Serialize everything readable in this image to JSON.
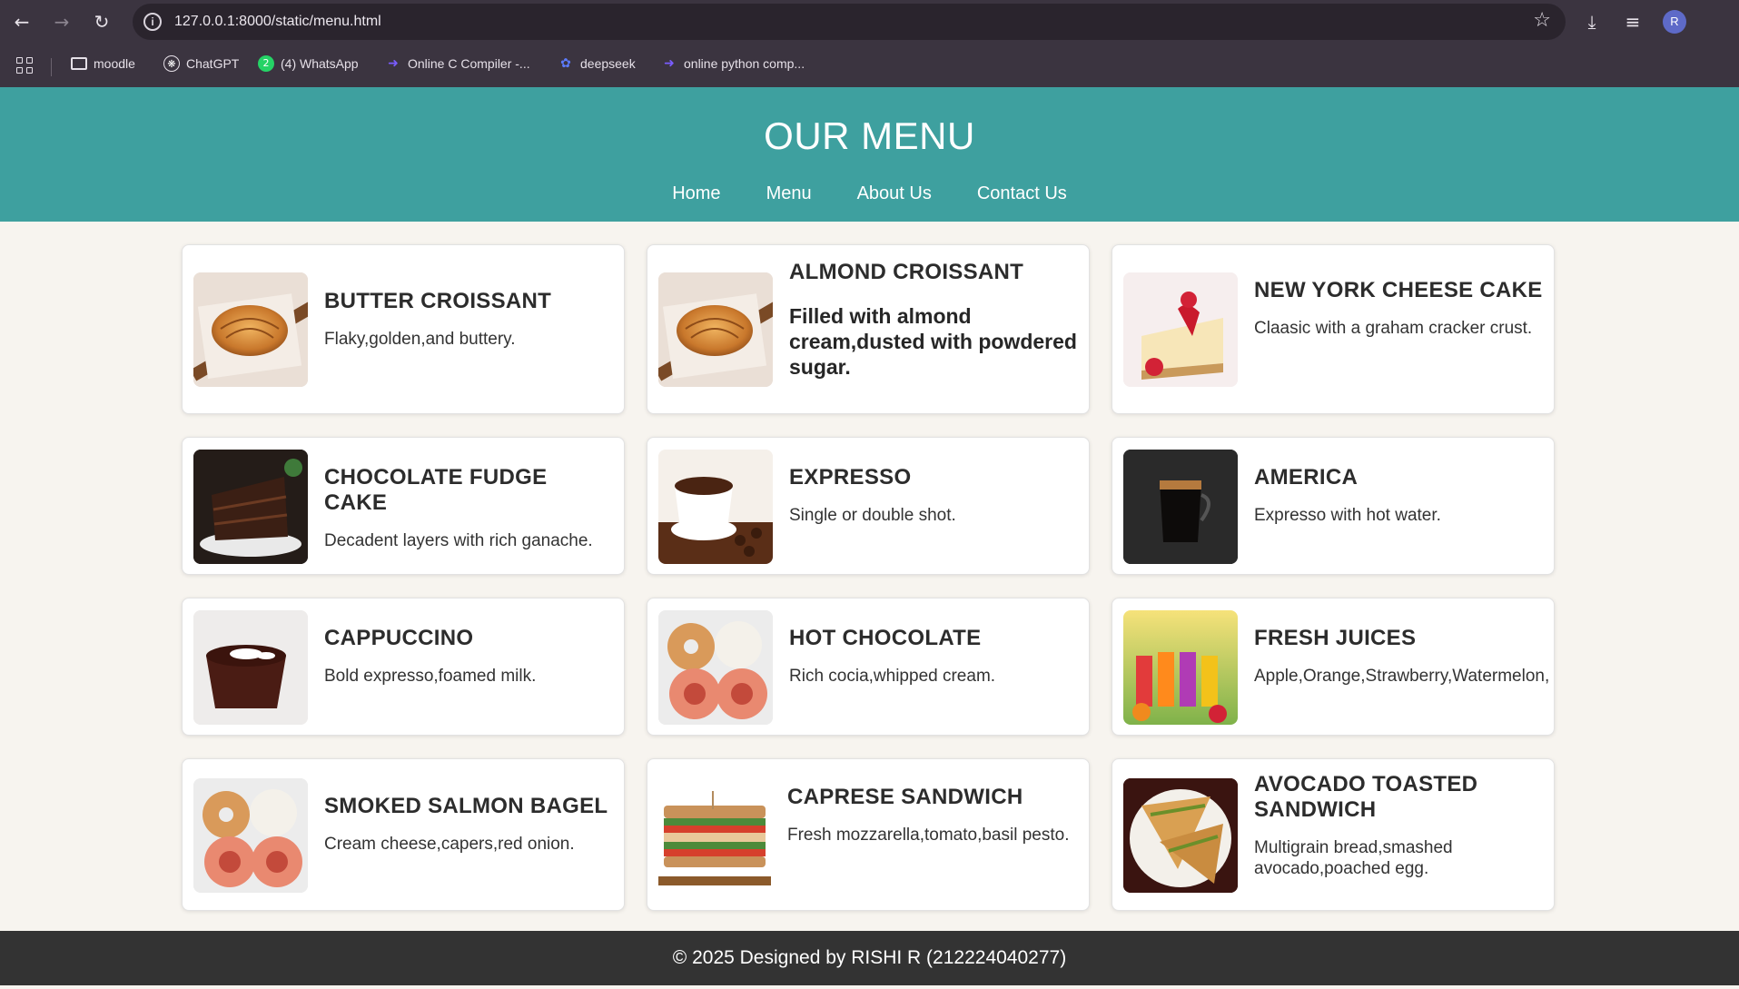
{
  "browser": {
    "url": "127.0.0.1:8000/static/menu.html",
    "bookmarks": [
      {
        "label": "moodle",
        "icon": "folder-icon"
      },
      {
        "label": "ChatGPT",
        "icon": "chatgpt-icon"
      },
      {
        "label": "(4) WhatsApp",
        "icon": "whatsapp-icon",
        "badge": "2"
      },
      {
        "label": "Online C Compiler -...",
        "icon": "compiler-icon"
      },
      {
        "label": "deepseek",
        "icon": "deepseek-icon"
      },
      {
        "label": "online python comp...",
        "icon": "compiler-icon"
      }
    ],
    "profile_initial": "R"
  },
  "header": {
    "title": "OUR MENU",
    "nav": [
      "Home",
      "Menu",
      "About Us",
      "Contact Us"
    ],
    "color": "#3ea09f"
  },
  "menu": [
    {
      "name": "BUTTER CROISSANT",
      "desc": "Flaky,golden,and buttery.",
      "image": "croissant"
    },
    {
      "name": "ALMOND CROISSANT",
      "desc": "Filled with almond cream,dusted with powdered sugar.",
      "image": "croissant"
    },
    {
      "name": "NEW YORK CHEESE CAKE",
      "desc": "Claasic with a graham cracker crust.",
      "image": "cheesecake"
    },
    {
      "name": "CHOCOLATE FUDGE CAKE",
      "desc": "Decadent layers with rich ganache.",
      "image": "chocolate-cake"
    },
    {
      "name": "EXPRESSO",
      "desc": "Single or double shot.",
      "image": "espresso"
    },
    {
      "name": "AMERICA",
      "desc": "Expresso with hot water.",
      "image": "americano"
    },
    {
      "name": "CAPPUCCINO",
      "desc": "Bold expresso,foamed milk.",
      "image": "hot-chocolate"
    },
    {
      "name": "HOT CHOCOLATE",
      "desc": "Rich cocia,whipped cream.",
      "image": "bagel"
    },
    {
      "name": "FRESH JUICES",
      "desc": "Apple,Orange,Strawberry,Watermelon,",
      "image": "juices"
    },
    {
      "name": "SMOKED SALMON BAGEL",
      "desc": "Cream cheese,capers,red onion.",
      "image": "bagel"
    },
    {
      "name": "CAPRESE SANDWICH",
      "desc": "Fresh mozzarella,tomato,basil pesto.",
      "image": "caprese-sandwich"
    },
    {
      "name": "AVOCADO TOASTED SANDWICH",
      "desc": "Multigrain bread,smashed avocado,poached egg.",
      "image": "toasted-sandwich"
    }
  ],
  "footer": {
    "text": "© 2025 Designed by RISHI R (212224040277)"
  }
}
